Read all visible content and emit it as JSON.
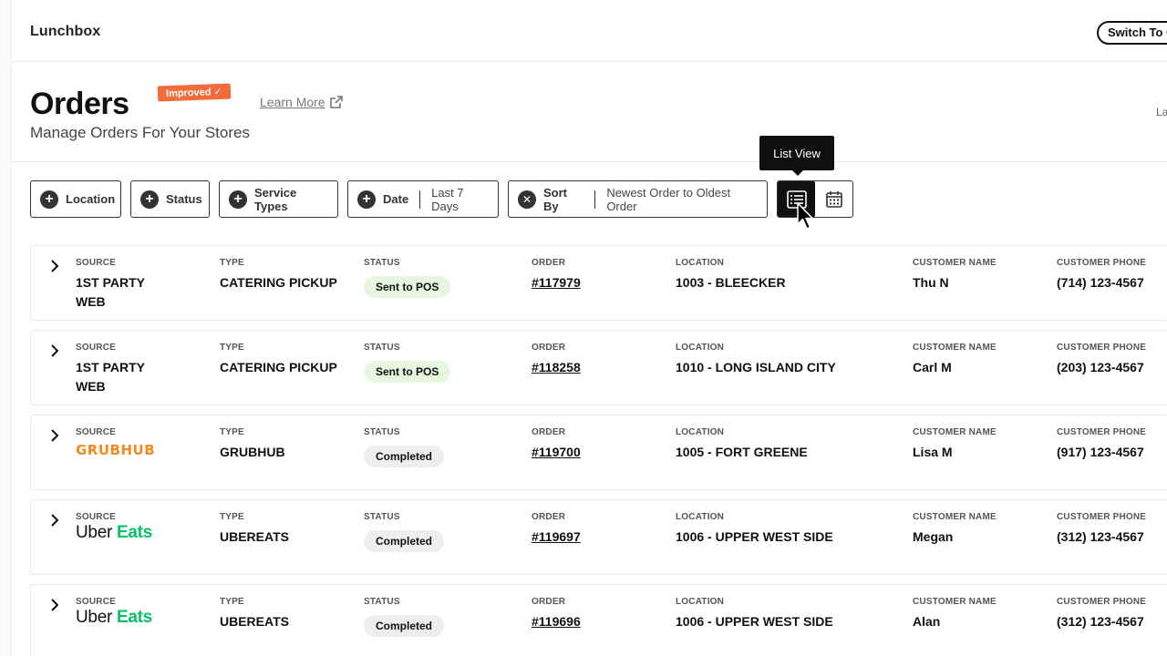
{
  "app": {
    "brand": "Lunchbox",
    "switch_label": "Switch To Classic"
  },
  "header": {
    "title": "Orders",
    "badge": "Improved ✓",
    "learn_more": "Learn More",
    "subtitle": "Manage Orders For Your Stores",
    "right_cut": "La"
  },
  "filters": {
    "location": "Location",
    "status": "Status",
    "service_types": "Service Types",
    "date_label": "Date",
    "date_value": "Last 7 Days",
    "sort_label": "Sort By",
    "sort_value": "Newest Order to Oldest Order"
  },
  "view_toggle": {
    "tooltip": "List View",
    "active": "list"
  },
  "columns": {
    "source": "SOURCE",
    "type": "TYPE",
    "status": "STATUS",
    "order": "ORDER",
    "location": "LOCATION",
    "customer_name": "CUSTOMER NAME",
    "customer_phone": "CUSTOMER PHONE"
  },
  "orders": [
    {
      "source_line1": "1ST PARTY",
      "source_line2": "WEB",
      "type": "CATERING PICKUP",
      "status": "Sent to POS",
      "order": "#117979",
      "location": "1003 - BLEECKER",
      "customer_name": "Thu N",
      "customer_phone": "(714) 123-4567"
    },
    {
      "source_line1": "1ST PARTY",
      "source_line2": "WEB",
      "type": "CATERING PICKUP",
      "status": "Sent to POS",
      "order": "#118258",
      "location": "1010 - LONG ISLAND CITY",
      "customer_name": "Carl M",
      "customer_phone": "(203) 123-4567"
    },
    {
      "source_logo": "GRUBHUB",
      "type": "GRUBHUB",
      "status": "Completed",
      "order": "#119700",
      "location": "1005 - FORT GREENE",
      "customer_name": "Lisa M",
      "customer_phone": "(917) 123-4567"
    },
    {
      "source_logo_a": "Uber",
      "source_logo_b": "Eats",
      "type": "UBEREATS",
      "status": "Completed",
      "order": "#119697",
      "location": "1006 - UPPER WEST SIDE",
      "customer_name": "Megan",
      "customer_phone": "(312) 123-4567"
    },
    {
      "source_logo_a": "Uber",
      "source_logo_b": "Eats",
      "type": "UBEREATS",
      "status": "Completed",
      "order": "#119696",
      "location": "1006 - UPPER WEST SIDE",
      "customer_name": "Alan",
      "customer_phone": "(312) 123-4567"
    }
  ],
  "colors": {
    "badge": "#f26b3a",
    "grubhub": "#f38a22",
    "uber_eats_green": "#06c167",
    "pill_green": "#e6f7e0",
    "pill_grey": "#eeeeee"
  }
}
